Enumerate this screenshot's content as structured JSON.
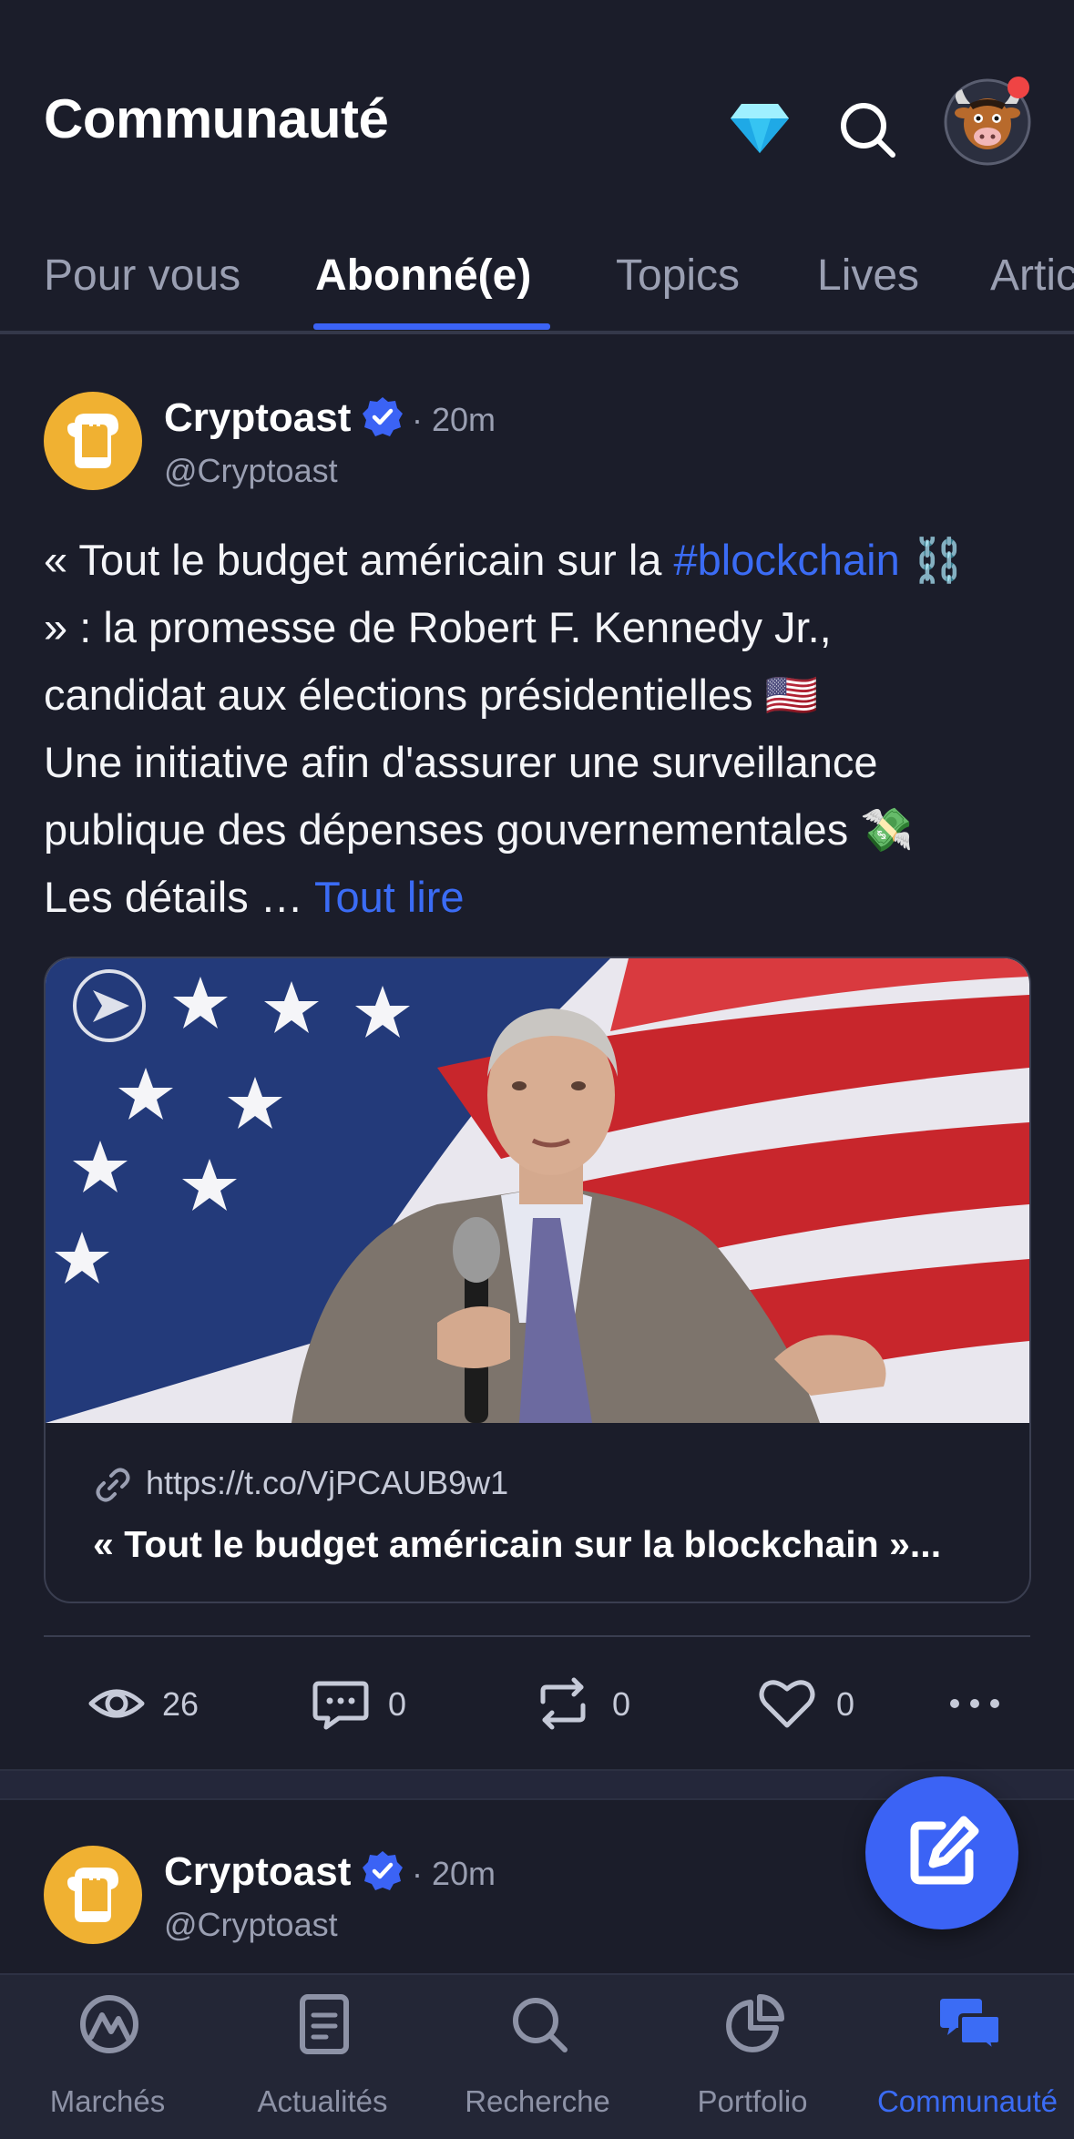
{
  "header": {
    "title": "Communauté",
    "icons": [
      "diamond-icon",
      "search-icon",
      "profile-avatar"
    ]
  },
  "tabs": [
    {
      "label": "Pour vous",
      "active": false
    },
    {
      "label": "Abonné(e)",
      "active": true
    },
    {
      "label": "Topics",
      "active": false
    },
    {
      "label": "Lives",
      "active": false
    },
    {
      "label": "Articles",
      "active": false
    }
  ],
  "post": {
    "author": "Cryptoast",
    "time": "· 20m",
    "handle": "@Cryptoast",
    "text": {
      "line1_before": "« Tout le budget américain sur la ",
      "hashtag": "#blockchain",
      "line1_emoji": " ⛓️",
      "line2": "» : la promesse de Robert F. Kennedy Jr.,",
      "line3": "candidat aux élections présidentielles 🇺🇸",
      "line4": "Une initiative afin d'assurer une surveillance",
      "line5": "publique des dépenses gouvernementales 💸",
      "line6": "Les détails …",
      "read_more": "Tout lire"
    },
    "link_card": {
      "url": "https://t.co/VjPCAUB9w1",
      "title": "« Tout le budget américain sur la blockchain »..."
    },
    "stats": {
      "views": "26",
      "comments": "0",
      "reposts": "0",
      "likes": "0"
    }
  },
  "post2": {
    "author": "Cryptoast",
    "time": "· 20m",
    "handle": "@Cryptoast"
  },
  "bottom_nav": [
    {
      "label": "Marchés",
      "icon": "markets-icon",
      "active": false
    },
    {
      "label": "Actualités",
      "icon": "news-icon",
      "active": false
    },
    {
      "label": "Recherche",
      "icon": "search-icon",
      "active": false
    },
    {
      "label": "Portfolio",
      "icon": "portfolio-icon",
      "active": false
    },
    {
      "label": "Communauté",
      "icon": "community-icon",
      "active": true
    }
  ],
  "colors": {
    "background": "#1b1d2a",
    "accent": "#3b63f5",
    "brand_yellow": "#f0b132",
    "muted_text": "#9a9fb2"
  }
}
